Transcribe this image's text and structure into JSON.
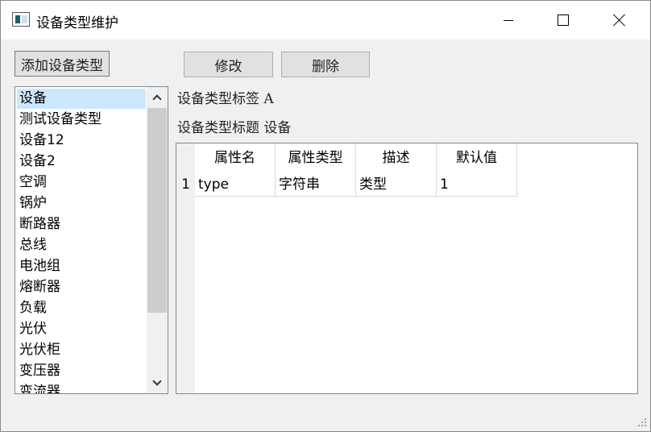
{
  "window": {
    "title": "设备类型维护"
  },
  "toolbar": {
    "add_label": "添加设备类型",
    "edit_label": "修改",
    "delete_label": "删除"
  },
  "device_types": {
    "items": [
      "设备",
      "测试设备类型",
      "设备12",
      "设备2",
      "空调",
      "锅炉",
      "断路器",
      "总线",
      "电池组",
      "熔断器",
      "负载",
      "光伏",
      "光伏柜",
      "变压器",
      "变流器"
    ],
    "selected_index": 0
  },
  "details": {
    "tag_text": "设备类型标签 A",
    "title_text": "设备类型标题 设备"
  },
  "attributes": {
    "columns": [
      "属性名",
      "属性类型",
      "描述",
      "默认值"
    ],
    "rows": [
      {
        "index": "1",
        "cells": [
          "type",
          "字符串",
          "类型",
          "1"
        ]
      }
    ]
  },
  "colors": {
    "selection": "#cce8ff",
    "window_bg": "#f0f0f0"
  }
}
